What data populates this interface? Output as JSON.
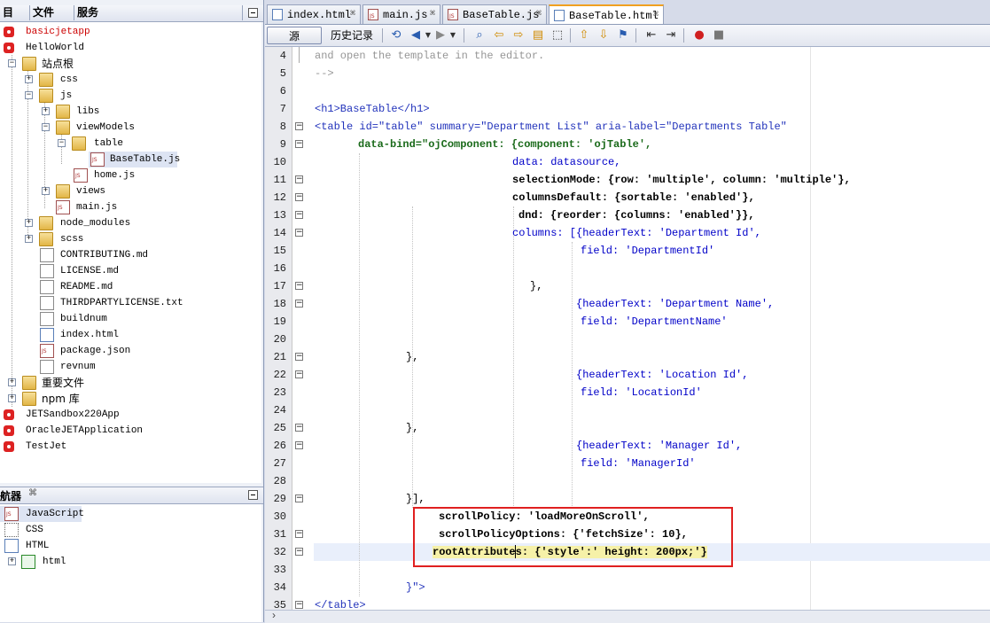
{
  "left_panel": {
    "tabs": [
      "目",
      "文件",
      "服务"
    ],
    "tree": [
      {
        "label": "basicjetapp",
        "color": "#cc0000"
      },
      {
        "label": "HelloWorld"
      },
      {
        "label": "站点根"
      },
      {
        "label": "css"
      },
      {
        "label": "js"
      },
      {
        "label": "libs"
      },
      {
        "label": "viewModels"
      },
      {
        "label": "table"
      },
      {
        "label": "BaseTable.js"
      },
      {
        "label": "home.js"
      },
      {
        "label": "views"
      },
      {
        "label": "main.js"
      },
      {
        "label": "node_modules"
      },
      {
        "label": "scss"
      },
      {
        "label": "CONTRIBUTING.md"
      },
      {
        "label": "LICENSE.md"
      },
      {
        "label": "README.md"
      },
      {
        "label": "THIRDPARTYLICENSE.txt"
      },
      {
        "label": "buildnum"
      },
      {
        "label": "index.html"
      },
      {
        "label": "package.json"
      },
      {
        "label": "revnum"
      },
      {
        "label": "重要文件"
      },
      {
        "label": "npm 库"
      },
      {
        "label": "JETSandbox220App"
      },
      {
        "label": "OracleJETApplication"
      },
      {
        "label": "TestJet"
      }
    ],
    "navigator_title": "航器",
    "navigator": [
      {
        "label": "JavaScript"
      },
      {
        "label": "CSS"
      },
      {
        "label": "HTML"
      },
      {
        "label": "html"
      }
    ]
  },
  "editor": {
    "tabs": [
      {
        "label": "index.html"
      },
      {
        "label": "main.js"
      },
      {
        "label": "BaseTable.js"
      },
      {
        "label": "BaseTable.html"
      }
    ],
    "toolbar": {
      "source": "源",
      "history": "历史记录"
    },
    "lines": [
      {
        "n": "4",
        "t": "and open the template in the editor."
      },
      {
        "n": "5",
        "t": "-->"
      },
      {
        "n": "6",
        "t": ""
      },
      {
        "n": "7",
        "t": "<h1>BaseTable</h1>"
      },
      {
        "n": "8",
        "t": "<table id=\"table\" summary=\"Department List\" aria-label=\"Departments Table\""
      },
      {
        "n": "9",
        "t": "data-bind=\"ojComponent: {component: 'ojTable',"
      },
      {
        "n": "10",
        "t": "data: datasource,"
      },
      {
        "n": "11",
        "t": "selectionMode: {row: 'multiple', column: 'multiple'},"
      },
      {
        "n": "12",
        "t": "columnsDefault: {sortable: 'enabled'},"
      },
      {
        "n": "13",
        "t": "dnd: {reorder: {columns: 'enabled'}},"
      },
      {
        "n": "14",
        "t": "columns: [{headerText: 'Department Id',"
      },
      {
        "n": "15",
        "t": "field: 'DepartmentId'"
      },
      {
        "n": "16",
        "t": ""
      },
      {
        "n": "17",
        "t": "},"
      },
      {
        "n": "18",
        "t": "{headerText: 'Department Name',"
      },
      {
        "n": "19",
        "t": "field: 'DepartmentName'"
      },
      {
        "n": "20",
        "t": ""
      },
      {
        "n": "21",
        "t": "},"
      },
      {
        "n": "22",
        "t": "{headerText: 'Location Id',"
      },
      {
        "n": "23",
        "t": "field: 'LocationId'"
      },
      {
        "n": "24",
        "t": ""
      },
      {
        "n": "25",
        "t": "},"
      },
      {
        "n": "26",
        "t": "{headerText: 'Manager Id',"
      },
      {
        "n": "27",
        "t": "field: 'ManagerId'"
      },
      {
        "n": "28",
        "t": ""
      },
      {
        "n": "29",
        "t": "}],"
      },
      {
        "n": "30",
        "t": "scrollPolicy: 'loadMoreOnScroll',"
      },
      {
        "n": "31",
        "t": "scrollPolicyOptions: {'fetchSize': 10},"
      },
      {
        "n": "32",
        "t": "rootAttributes: {'style':' height: 200px;'}"
      },
      {
        "n": "33",
        "t": ""
      },
      {
        "n": "34",
        "t": "}\">"
      },
      {
        "n": "35",
        "t": "</table>"
      }
    ]
  }
}
